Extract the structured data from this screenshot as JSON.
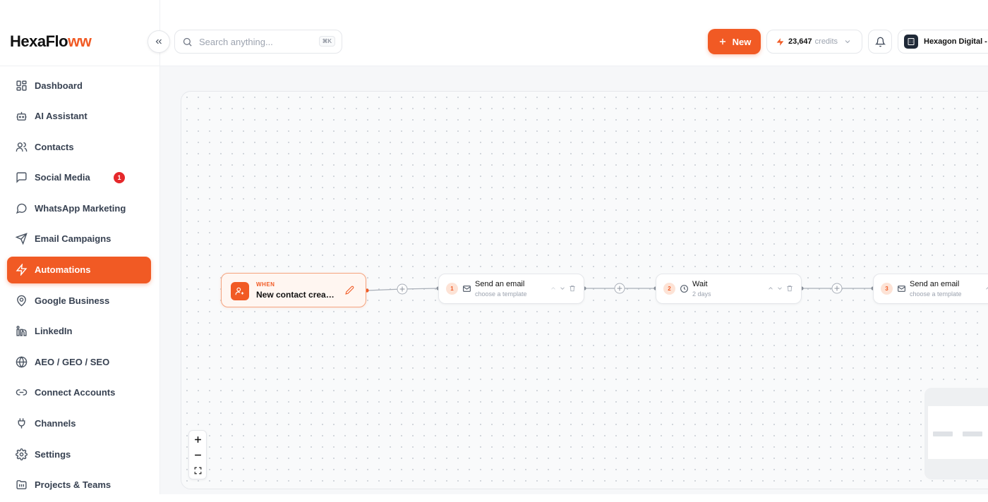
{
  "brand": {
    "name_main": "HexaFlo",
    "name_accent": "ww"
  },
  "sidebar": {
    "items": [
      {
        "label": "Dashboard",
        "icon": "dashboard-icon"
      },
      {
        "label": "AI Assistant",
        "icon": "robot-icon"
      },
      {
        "label": "Contacts",
        "icon": "users-icon"
      },
      {
        "label": "Social Media",
        "icon": "message-square-icon",
        "badge": "1"
      },
      {
        "label": "WhatsApp Marketing",
        "icon": "chat-bubble-icon"
      },
      {
        "label": "Email Campaigns",
        "icon": "send-icon"
      },
      {
        "label": "Automations",
        "icon": "bolt-icon",
        "active": true
      },
      {
        "label": "Google Business",
        "icon": "map-pin-icon"
      },
      {
        "label": "LinkedIn",
        "icon": "linkedin-icon"
      },
      {
        "label": "AEO / GEO / SEO",
        "icon": "globe-icon"
      },
      {
        "label": "Connect Accounts",
        "icon": "link-icon"
      },
      {
        "label": "Channels",
        "icon": "plug-icon"
      },
      {
        "label": "Settings",
        "icon": "gear-icon"
      },
      {
        "label": "Projects & Teams",
        "icon": "folder-icon"
      }
    ]
  },
  "header": {
    "search_placeholder": "Search anything...",
    "search_shortcut": "⌘K",
    "new_label": "New",
    "credits_value": "23,647",
    "credits_label": "credits",
    "workspace_name": "Hexagon Digital - D"
  },
  "flow": {
    "trigger": {
      "kicker": "WHEN",
      "title": "New contact created"
    },
    "steps": [
      {
        "num": "1",
        "title": "Send an email",
        "subtitle": "choose a template",
        "icon": "mail-icon"
      },
      {
        "num": "2",
        "title": "Wait",
        "subtitle": "2 days",
        "icon": "clock-icon"
      },
      {
        "num": "3",
        "title": "Send an email",
        "subtitle": "choose a template",
        "icon": "mail-icon"
      }
    ]
  },
  "colors": {
    "accent": "#f15a24",
    "badge": "#e5282b",
    "text": "#1f2937"
  }
}
